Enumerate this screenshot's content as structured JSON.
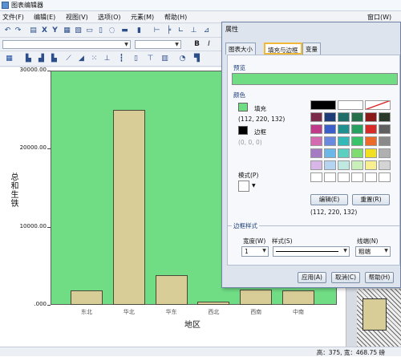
{
  "window": {
    "title": "图表编辑器"
  },
  "menu": [
    "文件(F)",
    "编辑(E)",
    "视图(V)",
    "选项(O)",
    "元素(M)",
    "帮助(H)",
    "窗口(W)"
  ],
  "toolbar": {
    "bold": "B",
    "italic": "I",
    "x_icon": "X",
    "y_icon": "Y"
  },
  "chart_data": {
    "type": "bar",
    "categories": [
      "东北",
      "华北",
      "华东",
      "西北",
      "西南",
      "中南"
    ],
    "values": [
      1800,
      25000,
      3800,
      400,
      2000,
      1900
    ],
    "ylabel": "总和生铁",
    "xlabel": "地区",
    "ylim": [
      0,
      30000
    ],
    "yticks": [
      "30000.00",
      "20000.00",
      "10000.00",
      ".000"
    ],
    "plot_color": "#70DC84",
    "bar_color": "#D8CD96"
  },
  "status": {
    "text": "高：375, 宽：468.75 磅"
  },
  "dialog": {
    "title": "属性",
    "tabs": [
      "图表大小",
      "填充与边框",
      "变量"
    ],
    "preview_label": "预览",
    "color_label": "颜色",
    "fill_label": "填充",
    "fill_value": "(112, 220, 132)",
    "fill_color": "#70DC84",
    "border_label": "边框",
    "border_value": "(0, 0, 0)",
    "pattern_label": "模式(P)",
    "edit_button": "编辑(E)",
    "reset_button": "重置(R)",
    "selected_value": "(112, 220, 132)",
    "border_style_label": "边框样式",
    "width_label": "宽度(W)",
    "style_label": "样式(S)",
    "end_label": "线端(N)",
    "width_value": "1",
    "end_value": "粗端",
    "apply_button": "应用(A)",
    "cancel_button": "取消(C)",
    "help_button": "帮助(H)",
    "palette": [
      "#000000",
      "#ffffff",
      "#ffffff",
      "#1a1a1a",
      "#7a2c4a",
      "#1e3c78",
      "#1f6d68",
      "#23704a",
      "#8a1a1a",
      "#2a3a2a",
      "#c03a8c",
      "#3a5fc8",
      "#1f8f8f",
      "#27a060",
      "#d92a2a",
      "#606060",
      "#d46ab0",
      "#6a8ae0",
      "#34b8b8",
      "#39c46a",
      "#ec6a2a",
      "#8a8a8a",
      "#a57bc4",
      "#6bb8e8",
      "#5cd0c0",
      "#7edc70",
      "#f0e020",
      "#b0b0b0",
      "#d8b6e8",
      "#b4d4f2",
      "#bfe8e0",
      "#c8f0b8",
      "#f8f090",
      "#d4d4d4",
      "#ffffff",
      "#ffffff",
      "#ffffff",
      "#ffffff",
      "#ffffff",
      "#ffffff"
    ]
  }
}
